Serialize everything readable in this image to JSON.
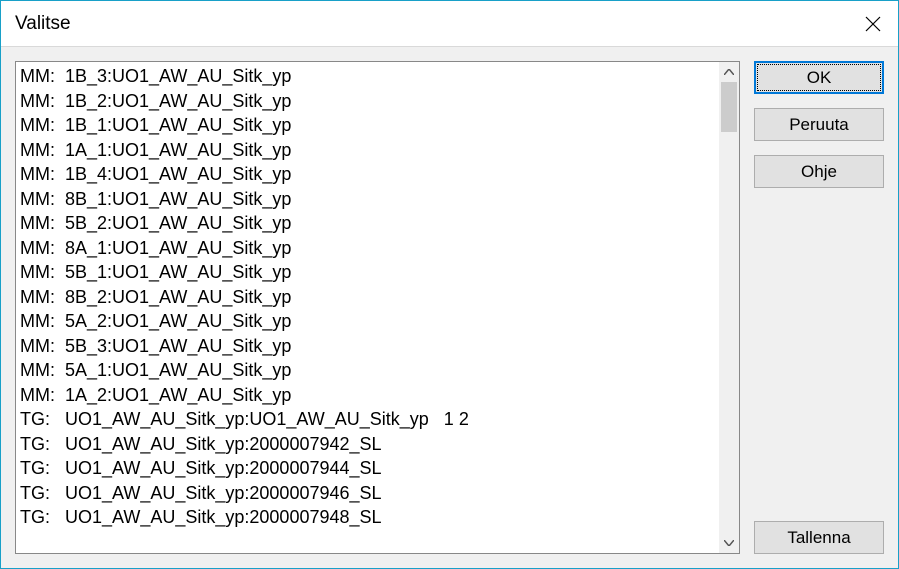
{
  "title": "Valitse",
  "buttons": {
    "ok": "OK",
    "cancel": "Peruuta",
    "help": "Ohje",
    "save": "Tallenna"
  },
  "list_items": [
    "MM:  1B_3:UO1_AW_AU_Sitk_yp",
    "MM:  1B_2:UO1_AW_AU_Sitk_yp",
    "MM:  1B_1:UO1_AW_AU_Sitk_yp",
    "MM:  1A_1:UO1_AW_AU_Sitk_yp",
    "MM:  1B_4:UO1_AW_AU_Sitk_yp",
    "MM:  8B_1:UO1_AW_AU_Sitk_yp",
    "MM:  5B_2:UO1_AW_AU_Sitk_yp",
    "MM:  8A_1:UO1_AW_AU_Sitk_yp",
    "MM:  5B_1:UO1_AW_AU_Sitk_yp",
    "MM:  8B_2:UO1_AW_AU_Sitk_yp",
    "MM:  5A_2:UO1_AW_AU_Sitk_yp",
    "MM:  5B_3:UO1_AW_AU_Sitk_yp",
    "MM:  5A_1:UO1_AW_AU_Sitk_yp",
    "MM:  1A_2:UO1_AW_AU_Sitk_yp",
    "TG:   UO1_AW_AU_Sitk_yp:UO1_AW_AU_Sitk_yp   1 2",
    "TG:   UO1_AW_AU_Sitk_yp:2000007942_SL",
    "TG:   UO1_AW_AU_Sitk_yp:2000007944_SL",
    "TG:   UO1_AW_AU_Sitk_yp:2000007946_SL",
    "TG:   UO1_AW_AU_Sitk_yp:2000007948_SL"
  ]
}
